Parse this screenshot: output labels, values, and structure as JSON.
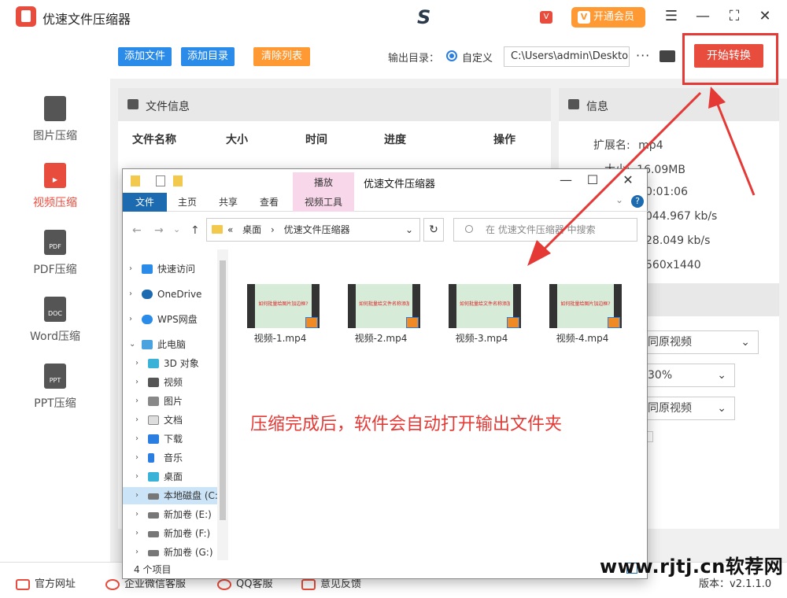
{
  "app": {
    "title": "优速文件压缩器",
    "vip_label": "开通会员",
    "vip_icon": "V",
    "badge_icon": "V"
  },
  "sidebar": {
    "items": [
      {
        "label": "图片压缩",
        "icon": "image-file-icon",
        "active": false
      },
      {
        "label": "视频压缩",
        "icon": "video-file-icon",
        "active": true
      },
      {
        "label": "PDF压缩",
        "icon": "PDF",
        "active": false
      },
      {
        "label": "Word压缩",
        "icon": "DOC",
        "active": false
      },
      {
        "label": "PPT压缩",
        "icon": "PPT",
        "active": false
      }
    ]
  },
  "toolbar": {
    "add_file": "添加文件",
    "add_folder": "添加目录",
    "clear_list": "清除列表",
    "output_label": "输出目录：",
    "output_option": "自定义",
    "output_path": "C:\\Users\\admin\\Deskto",
    "start": "开始转换"
  },
  "file_panel": {
    "title": "文件信息",
    "columns": [
      "文件名称",
      "大小",
      "时间",
      "进度",
      "操作"
    ]
  },
  "info_panel": {
    "title": "信息",
    "rows": [
      {
        "key": "扩展名:",
        "value": "mp4"
      },
      {
        "key": "大小:",
        "value": "16.09MB"
      },
      {
        "key": "",
        "value": "0:01:06"
      },
      {
        "key": "",
        "value": "044.967 kb/s"
      },
      {
        "key": "",
        "value": "28.049 kb/s"
      },
      {
        "key": "",
        "value": "560x1440"
      }
    ],
    "options": [
      "同原视频",
      "30%",
      "同原视频"
    ]
  },
  "explorer": {
    "window_title": "优速文件压缩器",
    "play_tab": "播放",
    "ribbon": [
      "文件",
      "主页",
      "共享",
      "查看",
      "视频工具"
    ],
    "address": [
      "«",
      "桌面",
      "›",
      "优速文件压缩器"
    ],
    "search_placeholder": "在 优速文件压缩器 中搜索",
    "nav": [
      "快速访问",
      "OneDrive",
      "WPS网盘",
      "此电脑",
      "3D 对象",
      "视频",
      "图片",
      "文档",
      "下载",
      "音乐",
      "桌面",
      "本地磁盘 (C:",
      "新加卷 (E:)",
      "新加卷 (F:)",
      "新加卷 (G:)"
    ],
    "files": [
      {
        "name": "视频-1.mp4",
        "thumb_title": "如何批量给图片加边框?"
      },
      {
        "name": "视频-2.mp4",
        "thumb_title": "如何批量给文件名称添加序号"
      },
      {
        "name": "视频-3.mp4",
        "thumb_title": "如何批量给文件名称添加序号"
      },
      {
        "name": "视频-4.mp4",
        "thumb_title": "如何批量给图片加边框?"
      }
    ],
    "status": "4 个项目"
  },
  "annotation": "压缩完成后，软件会自动打开输出文件夹",
  "footer": {
    "items": [
      "官方网址",
      "企业微信客服",
      "QQ客服",
      "意见反馈"
    ],
    "version": "版本：v2.1.1.0"
  },
  "watermark": "www.rjtj.cn软荐网",
  "colors": {
    "accent": "#e84c3d",
    "blue_btn": "#2a8be8",
    "orange_btn": "#ff9933",
    "highlight": "#e53935"
  }
}
